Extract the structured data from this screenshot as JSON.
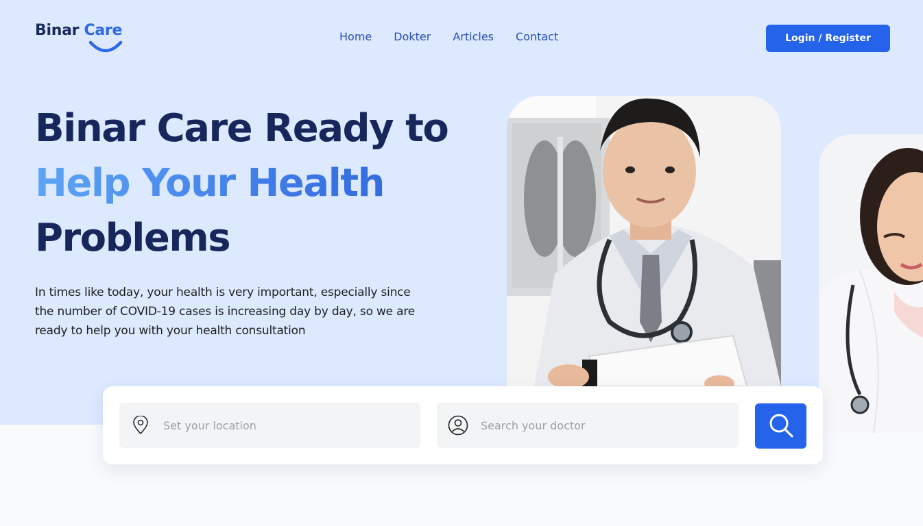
{
  "brand": {
    "name_part1": "Binar",
    "name_part2": "Care"
  },
  "nav": {
    "items": [
      {
        "label": "Home"
      },
      {
        "label": "Dokter"
      },
      {
        "label": "Articles"
      },
      {
        "label": "Contact"
      }
    ]
  },
  "auth": {
    "login_label": "Login / Register"
  },
  "hero": {
    "title_line1": "Binar Care Ready to",
    "title_line2": "Help Your Health",
    "title_line3": "Problems",
    "description": "In times like today, your health is very important, especially since the number of COVID-19 cases is increasing day by day, so we are ready to help you with your health consultation"
  },
  "search": {
    "location_placeholder": "Set your location",
    "doctor_placeholder": "Search your doctor"
  },
  "colors": {
    "primary": "#2563eb",
    "hero_background": "#dce9fe",
    "heading": "#17275c"
  },
  "icons": {
    "location": "location-pin-icon",
    "doctor": "user-circle-icon",
    "search": "search-icon"
  }
}
